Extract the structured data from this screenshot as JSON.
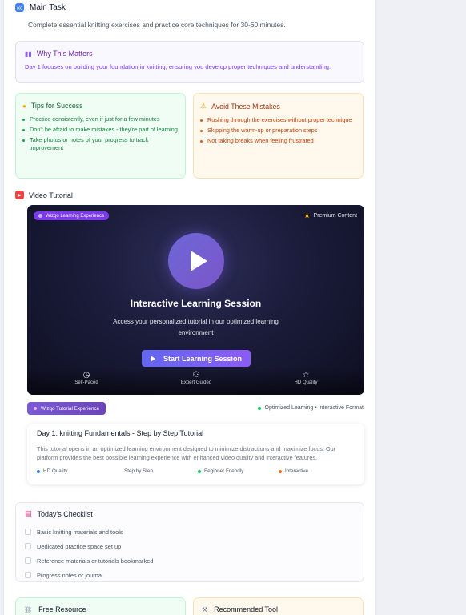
{
  "main_task": {
    "title": "Main Task",
    "description": "Complete essential knitting exercises and practice core techniques for 30-60 minutes."
  },
  "why": {
    "title": "Why This Matters",
    "text": "Day 1 focuses on building your foundation in knitting, ensuring you develop proper techniques and understanding."
  },
  "tips": {
    "title": "Tips for Success",
    "items": [
      "Practice consistently, even if just for a few minutes",
      "Don't be afraid to make mistakes - they're part of learning",
      "Take photos or notes of your progress to track improvement"
    ]
  },
  "avoid": {
    "title": "Avoid These Mistakes",
    "items": [
      "Rushing through the exercises without proper technique",
      "Skipping the warm-up or preparation steps",
      "Not taking breaks when feeling frustrated"
    ]
  },
  "video_section": {
    "title": "Video Tutorial"
  },
  "video": {
    "badge": "Wizqo Learning Experience",
    "premium": "Premium Content",
    "title": "Interactive Learning Session",
    "subtitle": "Access your personalized tutorial in our optimized learning environment",
    "button": "Start Learning Session",
    "features": [
      "Self-Paced",
      "Expert Guided",
      "HD Quality"
    ]
  },
  "tutorial": {
    "badge": "Wizqo Tutorial Experience",
    "status": "Optimized Learning • Interactive Format",
    "title": "Day 1: knitting Fundamentals - Step by Step Tutorial",
    "description": "This tutorial opens in an optimized learning environment designed to minimize distractions and maximize focus. Our platform provides the best possible learning experience with enhanced video quality and interactive features.",
    "tags": [
      "HD Quality",
      "Step by Step",
      "Beginner Friendly",
      "Interactive"
    ]
  },
  "checklist": {
    "title": "Today's Checklist",
    "items": [
      "Basic knitting materials and tools",
      "Dedicated practice space set up",
      "Reference materials or tutorials bookmarked",
      "Progress notes or journal"
    ]
  },
  "free_resource": {
    "title": "Free Resource"
  },
  "recommended_tool": {
    "title": "Recommended Tool"
  },
  "colors": {
    "accent": "#7c3aed",
    "tips_green": "#16a34a",
    "avoid_orange": "#ea580c"
  }
}
